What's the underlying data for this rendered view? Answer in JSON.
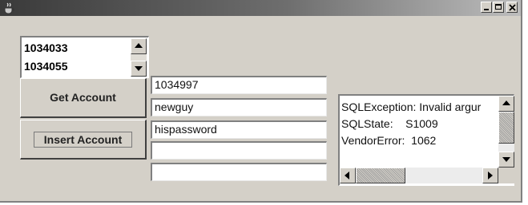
{
  "window": {
    "title": "",
    "controls": {
      "minimize": "_",
      "maximize": "□",
      "close": "×"
    }
  },
  "account_list": {
    "items": [
      "1034033",
      "1034055"
    ]
  },
  "buttons": {
    "get_account": "Get Account",
    "insert_account": "Insert Account"
  },
  "fields": [
    {
      "value": "1034997"
    },
    {
      "value": "newguy"
    },
    {
      "value": "hispassword"
    },
    {
      "value": ""
    },
    {
      "value": ""
    }
  ],
  "output": {
    "lines": [
      "SQLException: Invalid argur",
      "SQLState:    S1009",
      "VendorError:  1062"
    ]
  },
  "icons": {
    "app": "java-cup-icon",
    "scroll_up": "arrow-up-icon",
    "scroll_down": "arrow-down-icon",
    "scroll_left": "arrow-left-icon",
    "scroll_right": "arrow-right-icon"
  }
}
